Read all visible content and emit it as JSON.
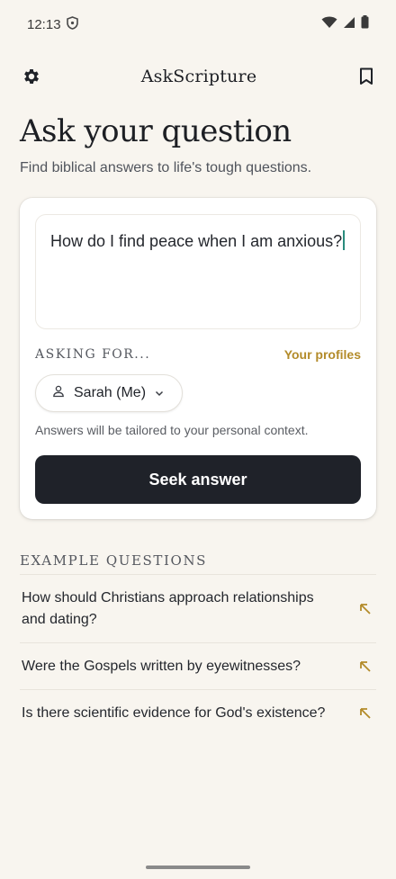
{
  "status_bar": {
    "time": "12:13"
  },
  "app_bar": {
    "title": "AskScripture"
  },
  "hero": {
    "title": "Ask your question",
    "subtitle": "Find biblical answers to life's tough questions."
  },
  "form": {
    "question_value": "How do I find peace when I am anxious?",
    "asking_label": "ASKING FOR...",
    "profiles_link": "Your profiles",
    "profile_selected": "Sarah (Me)",
    "tailored_note": "Answers will be tailored to your personal context.",
    "submit_label": "Seek answer"
  },
  "examples": {
    "heading": "EXAMPLE QUESTIONS",
    "items": [
      "How should Christians approach relationships and dating?",
      "Were the Gospels written by eyewitnesses?",
      "Is there scientific evidence for God's existence?"
    ]
  },
  "colors": {
    "background": "#f8f5ef",
    "accent_gold": "#b38b2a",
    "button_dark": "#1f2229",
    "caret_teal": "#2a8c7d"
  },
  "icons": {
    "settings": "gear-icon",
    "bookmark": "bookmark-icon",
    "person": "person-icon",
    "dropdown": "chevron-down-icon",
    "example_arrow": "arrow-up-left-icon",
    "status_shield": "shield-icon",
    "status_wifi": "wifi-icon",
    "status_signal": "signal-icon",
    "status_battery": "battery-icon"
  }
}
